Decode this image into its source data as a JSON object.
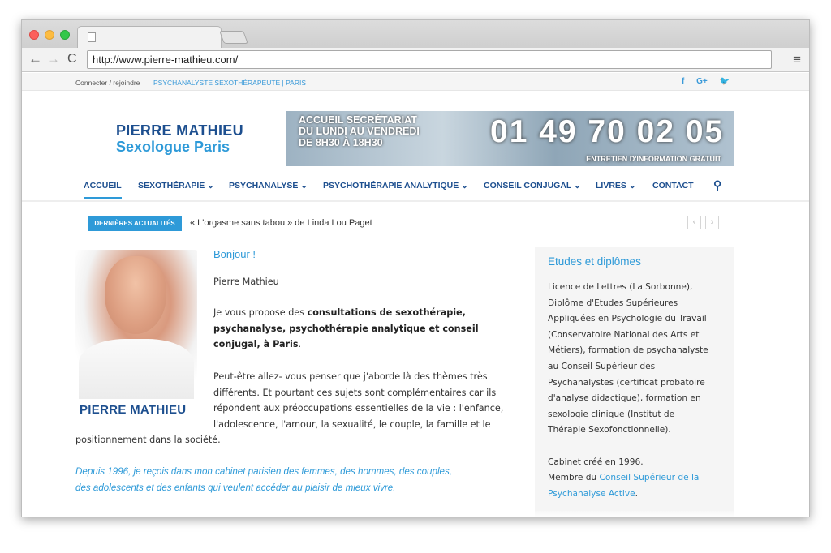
{
  "browser": {
    "url": "http://www.pierre-mathieu.com/",
    "back": "←",
    "forward": "→",
    "reload": "C",
    "menu": "≡"
  },
  "topbar": {
    "login": "Connecter / rejoindre",
    "tagline": "PSYCHANALYSTE SEXOTHÉRAPEUTE | PARIS",
    "social": [
      "f",
      "G+",
      "🐦"
    ]
  },
  "header": {
    "logo_line1": "PIERRE MATHIEU",
    "logo_line2": "Sexologue Paris",
    "banner_line1": "ACCUEIL SECRÉTARIAT",
    "banner_line2": "DU LUNDI AU VENDREDI",
    "banner_line3": "DE 8H30 À 18H30",
    "banner_phone": "01 49 70 02 05",
    "banner_sub": "ENTRETIEN D'INFORMATION GRATUIT"
  },
  "nav": {
    "items": [
      {
        "label": "ACCUEIL"
      },
      {
        "label": "SEXOTHÉRAPIE ⌄"
      },
      {
        "label": "PSYCHANALYSE ⌄"
      },
      {
        "label": "PSYCHOTHÉRAPIE ANALYTIQUE ⌄"
      },
      {
        "label": "CONSEIL CONJUGAL ⌄"
      },
      {
        "label": "LIVRES ⌄"
      },
      {
        "label": "CONTACT"
      }
    ],
    "search_icon": "⚲"
  },
  "ticker": {
    "label": "DERNIÈRES ACTUALITÉS",
    "text": "« L'orgasme sans tabou » de Linda Lou Paget",
    "prev": "‹",
    "next": "›"
  },
  "main": {
    "photo_caption": "PIERRE MATHIEU",
    "greeting": "Bonjour !",
    "author": "Pierre Mathieu",
    "intro_prefix": "Je vous propose des ",
    "intro_bold_line1": "consultations de sexothérapie,",
    "intro_bold_line2": "psychanalyse, psychothérapie analytique et conseil",
    "intro_bold_line3": "conjugal, à Paris",
    "intro_suffix": ".",
    "para2_line1": "Peut-être allez- vous penser que j'aborde là des thèmes très",
    "para2_line2": "différents. Et pourtant ces sujets sont complémentaires car ils",
    "para2_line3": "répondent aux préoccupations essentielles de la vie : l'enfance,",
    "para2_line4": "l'adolescence, l'amour, la sexualité, le couple, la famille et le",
    "para2_line5": "positionnement dans la société.",
    "italic_line1": "Depuis 1996, je reçois dans mon cabinet parisien des femmes, des hommes, des couples,",
    "italic_line2": "des adolescents et des enfants qui veulent accéder au plaisir de mieux vivre."
  },
  "sidebar": {
    "title": "Etudes et diplômes",
    "lines": [
      "Licence de Lettres (La Sorbonne),",
      "Diplôme d'Etudes Supérieures",
      "Appliquées en Psychologie du Travail",
      "(Conservatoire National des Arts et",
      "Métiers), formation de psychanalyste",
      "au Conseil Supérieur des",
      "Psychanalystes (certificat probatoire",
      "d'analyse didactique), formation en",
      "sexologie clinique (Institut de",
      "Thérapie Sexofonctionnelle)."
    ],
    "created": "Cabinet créé en 1996.",
    "member_prefix": "Membre du ",
    "member_link_line1": "Conseil Supérieur de la",
    "member_link_line2": "Psychanalyse Active",
    "member_suffix": "."
  }
}
